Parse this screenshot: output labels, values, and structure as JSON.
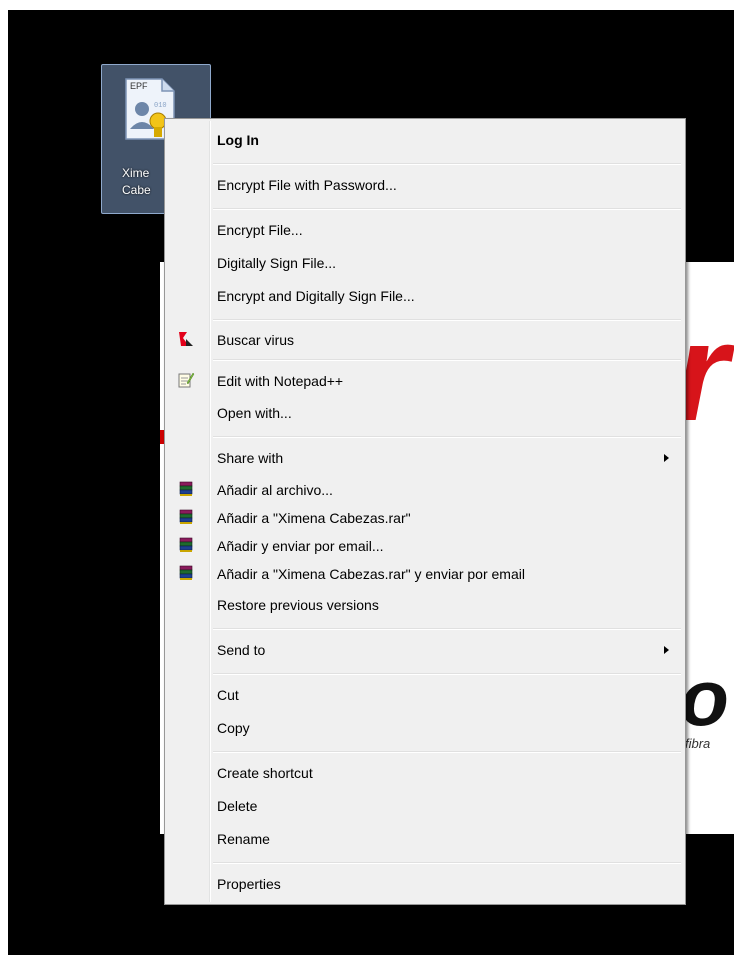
{
  "desktop": {
    "icon": {
      "badge_text": "EPF",
      "label_line1": "Xime",
      "label_line2": "Cabe"
    },
    "background": {
      "fragment_r": "r",
      "fragment_o": "o",
      "fragment_fibra": "fibra"
    }
  },
  "menu": {
    "items": {
      "log_in": "Log In",
      "encrypt_password": "Encrypt File with Password...",
      "encrypt_file": "Encrypt File...",
      "sign_file": "Digitally Sign File...",
      "encrypt_sign": "Encrypt and Digitally Sign File...",
      "buscar_virus": "Buscar virus",
      "edit_notepad": "Edit with Notepad++",
      "open_with": "Open with...",
      "share_with": "Share with",
      "anadir_archivo": "Añadir al archivo...",
      "anadir_rar": "Añadir a \"Ximena Cabezas.rar\"",
      "anadir_email": "Añadir y enviar por email...",
      "anadir_rar_email": "Añadir a \"Ximena Cabezas.rar\" y enviar por email",
      "restore": "Restore previous versions",
      "send_to": "Send to",
      "cut": "Cut",
      "copy": "Copy",
      "create_shortcut": "Create shortcut",
      "delete": "Delete",
      "rename": "Rename",
      "properties": "Properties"
    },
    "icons": {
      "kaspersky": "kaspersky-icon",
      "notepad": "notepad-plus-plus-icon",
      "winrar": "winrar-icon",
      "submenu": "chevron-right-icon"
    }
  },
  "colors": {
    "menu_bg": "#f0f0f0",
    "desktop_bg": "#000000",
    "accent_red": "#d7141a"
  }
}
